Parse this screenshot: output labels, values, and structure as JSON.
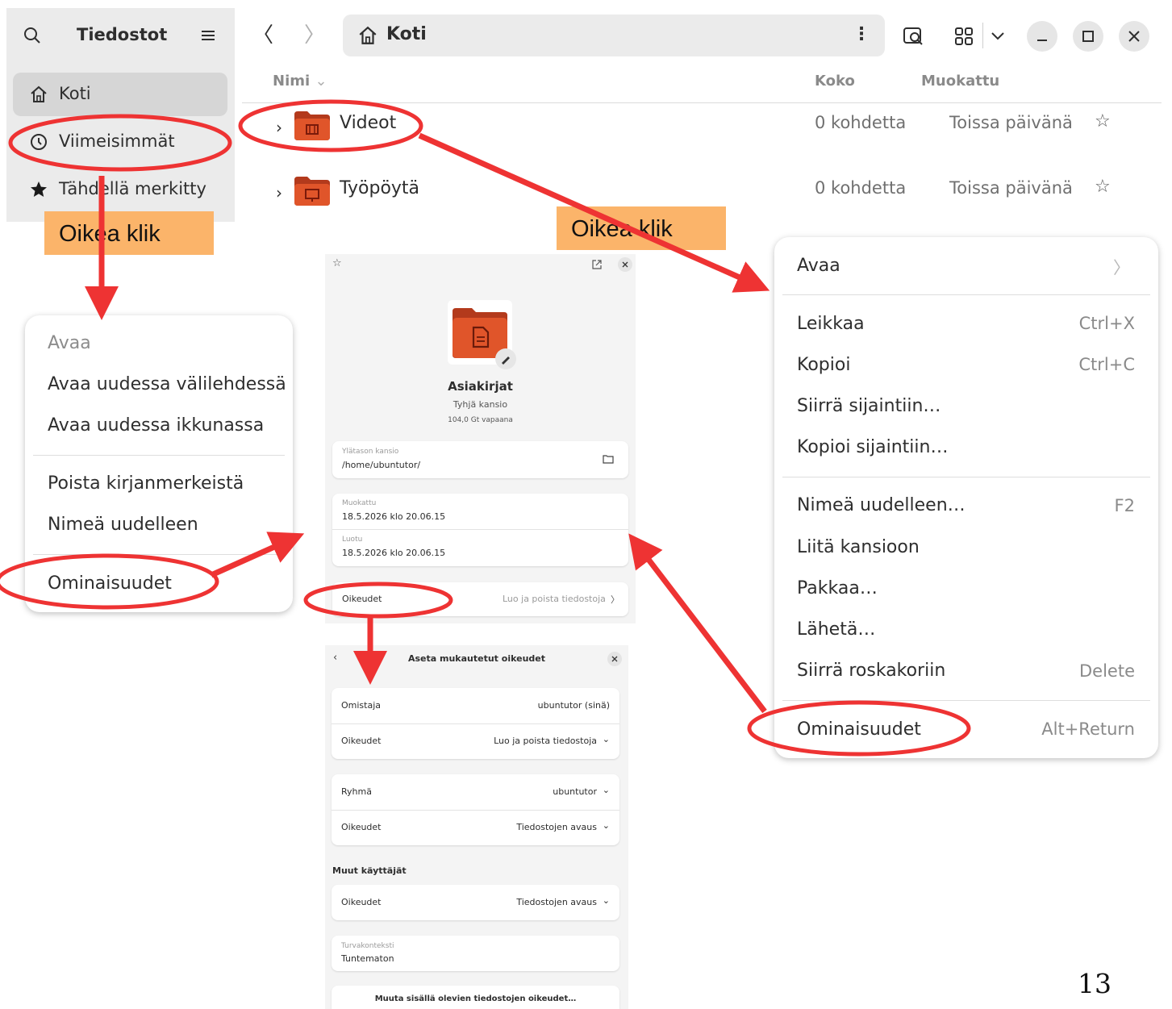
{
  "sidebar": {
    "title": "Tiedostot",
    "items": [
      {
        "label": "Koti",
        "icon": "home-icon"
      },
      {
        "label": "Viimeisimmät",
        "icon": "clock-icon"
      },
      {
        "label": "Tähdellä merkitty",
        "icon": "star-icon"
      }
    ]
  },
  "header": {
    "path_label": "Koti",
    "path_menu": "⋮",
    "back": "〈",
    "forward": "〉"
  },
  "file_list": {
    "columns": {
      "name": "Nimi",
      "size": "Koko",
      "modified": "Muokattu"
    },
    "rows": [
      {
        "name": "Videot",
        "size": "0 kohdetta",
        "modified": "Toissa päivänä",
        "icon": "videos-folder-icon"
      },
      {
        "name": "Työpöytä",
        "size": "0 kohdetta",
        "modified": "Toissa päivänä",
        "icon": "desktop-folder-icon"
      }
    ]
  },
  "annotations": {
    "left_label": "Oikea klik",
    "right_label": "Oikea klik",
    "annotation_color": "#ee3333",
    "label_bg": "#fbb46a"
  },
  "sidebar_menu": {
    "items": [
      {
        "label": "Avaa",
        "disabled": true
      },
      {
        "label": "Avaa uudessa välilehdessä"
      },
      {
        "label": "Avaa uudessa ikkunassa"
      },
      {
        "label": "Poista kirjanmerkeistä"
      },
      {
        "label": "Nimeä uudelleen"
      },
      {
        "label": "Ominaisuudet"
      }
    ]
  },
  "file_menu": {
    "items": [
      {
        "label": "Avaa",
        "accel": "〉"
      },
      {
        "label": "Leikkaa",
        "accel": "Ctrl+X"
      },
      {
        "label": "Kopioi",
        "accel": "Ctrl+C"
      },
      {
        "label": "Siirrä sijaintiin…",
        "accel": ""
      },
      {
        "label": "Kopioi sijaintiin…",
        "accel": ""
      },
      {
        "label": "Nimeä uudelleen…",
        "accel": "F2"
      },
      {
        "label": "Liitä kansioon",
        "accel": ""
      },
      {
        "label": "Pakkaa…",
        "accel": ""
      },
      {
        "label": "Lähetä…",
        "accel": ""
      },
      {
        "label": "Siirrä roskakoriin",
        "accel": "Delete"
      },
      {
        "label": "Ominaisuudet",
        "accel": "Alt+Return"
      }
    ]
  },
  "properties": {
    "name": "Asiakirjat",
    "subtitle": "Tyhjä kansio",
    "free_space": "104,0 Gt vapaana",
    "parent_label": "Ylätason kansio",
    "parent_value": "/home/ubuntutor/",
    "modified_label": "Muokattu",
    "modified_value": "18.5.2026 klo 20.06.15",
    "created_label": "Luotu",
    "created_value": "18.5.2026 klo 20.06.15",
    "permissions_label": "Oikeudet",
    "permissions_value": "Luo ja poista tiedostoja",
    "permissions_chevron": "〉"
  },
  "permissions_dialog": {
    "title": "Aseta mukautetut oikeudet",
    "owner_label": "Omistaja",
    "owner_value": "ubuntutor (sinä)",
    "owner_perm_label": "Oikeudet",
    "owner_perm_value": "Luo ja poista tiedostoja",
    "group_label": "Ryhmä",
    "group_value": "ubuntutor",
    "group_perm_label": "Oikeudet",
    "group_perm_value": "Tiedostojen avaus",
    "others_heading": "Muut käyttäjät",
    "others_perm_label": "Oikeudet",
    "others_perm_value": "Tiedostojen avaus",
    "context_label": "Turvakonteksti",
    "context_value": "Tuntematon",
    "apply_button": "Muuta sisällä olevien tiedostojen oikeudet…"
  },
  "page_number": "13"
}
